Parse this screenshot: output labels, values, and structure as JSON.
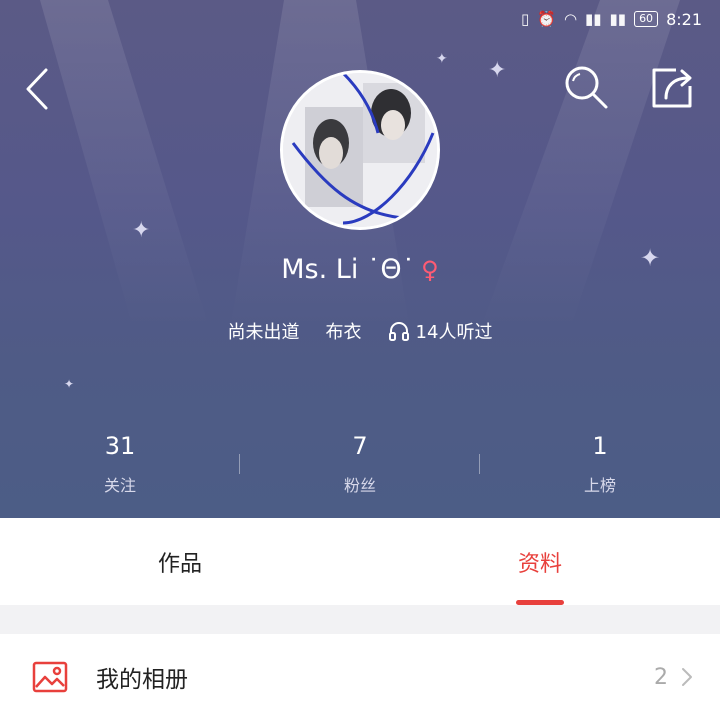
{
  "status_bar": {
    "time": "8:21",
    "battery": "60"
  },
  "profile": {
    "username": "Ms. Li ˙Θ˙",
    "gender_symbol": "♀",
    "status": "尚未出道",
    "location": "布衣",
    "listens": "14人听过"
  },
  "stats": [
    {
      "value": "31",
      "label": "关注"
    },
    {
      "value": "7",
      "label": "粉丝"
    },
    {
      "value": "1",
      "label": "上榜"
    }
  ],
  "tabs": [
    {
      "label": "作品"
    },
    {
      "label": "资料"
    }
  ],
  "album": {
    "label": "我的相册",
    "count": "2"
  },
  "colors": {
    "accent": "#e8403c",
    "hero_top": "#5b5a86",
    "hero_bottom": "#4c5d86",
    "gender": "#ff5b73"
  },
  "icons": [
    "back-arrow-icon",
    "search-icon",
    "share-icon",
    "headphones-icon",
    "album-icon",
    "chevron-right-icon"
  ]
}
